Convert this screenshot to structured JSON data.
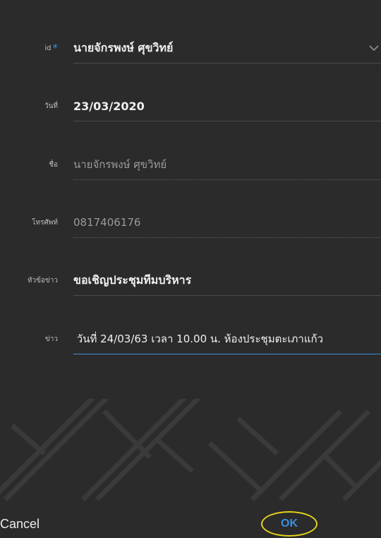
{
  "form": {
    "id": {
      "label": "id",
      "required_mark": "*",
      "value": "นายจักรพงษ์ ศุขวิทย์"
    },
    "date": {
      "label": "วันที่",
      "value": "23/03/2020"
    },
    "name": {
      "label": "ชื่อ",
      "value": "นายจักรพงษ์  ศุขวิทย์"
    },
    "phone": {
      "label": "โทรศัพท์",
      "value": "0817406176"
    },
    "headline": {
      "label": "หัวข้อข่าว",
      "value": "ขอเชิญประชุมทีมบริหาร"
    },
    "news": {
      "label": "ข่าว",
      "value": "ุ วันที่ 24/03/63 เวลา 10.00 น. ห้องประชุมตะเภาแก้ว"
    }
  },
  "dialog": {
    "cancel_label": "Cancel",
    "ok_label": "OK"
  },
  "colors": {
    "background": "#2b2b2b",
    "accent": "#3a8fe0",
    "highlight": "#e6d41a"
  }
}
